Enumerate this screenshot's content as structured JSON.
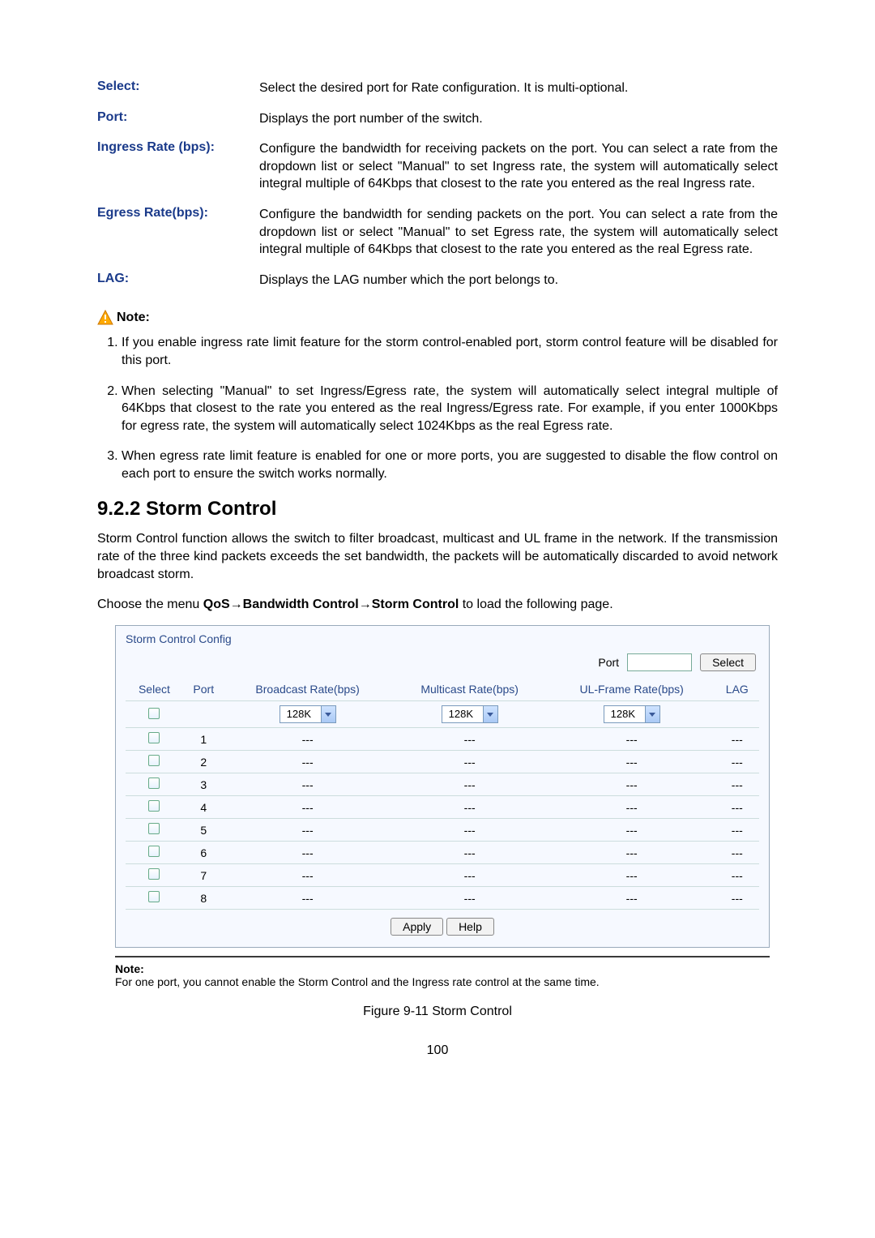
{
  "definitions": [
    {
      "term": "Select:",
      "desc": "Select the desired port for Rate configuration. It is multi-optional."
    },
    {
      "term": "Port:",
      "desc": "Displays the port number of the switch."
    },
    {
      "term": "Ingress Rate (bps):",
      "desc": "Configure the bandwidth for receiving packets on the port. You can select a rate from the dropdown list or select \"Manual\" to set Ingress rate, the system will automatically select integral multiple of 64Kbps that closest to the rate you entered as the real Ingress rate."
    },
    {
      "term": "Egress Rate(bps):",
      "desc": "Configure the bandwidth for sending packets on the port. You can select a rate from the dropdown list or select \"Manual\" to set Egress rate, the system will automatically select integral multiple of 64Kbps that closest to the rate you entered as the real Egress rate."
    },
    {
      "term": "LAG:",
      "desc": "Displays the LAG number which the port belongs to."
    }
  ],
  "note_label": "Note:",
  "notes": [
    "If you enable ingress rate limit feature for the storm control-enabled port, storm control feature will be disabled for this port.",
    "When selecting \"Manual\" to set Ingress/Egress rate, the system will automatically select integral multiple of 64Kbps that closest to the rate you entered as the real Ingress/Egress rate. For example, if you enter 1000Kbps for egress rate, the system will automatically select 1024Kbps as the real Egress rate.",
    "When egress rate limit feature is enabled for one or more ports, you are suggested to disable the flow control on each port to ensure the switch works normally."
  ],
  "section_heading": "9.2.2 Storm Control",
  "section_para1": "Storm Control function allows the switch to filter broadcast, multicast and UL frame in the network. If the transmission rate of the three kind packets exceeds the set bandwidth, the packets will be automatically discarded to avoid network broadcast storm.",
  "section_para2_pre": "Choose the menu ",
  "menu_path_1": "QoS",
  "arrow": "→",
  "menu_path_2": "Bandwidth Control",
  "menu_path_3": "Storm Control",
  "section_para2_post": " to load the following page.",
  "panel": {
    "title": "Storm Control Config",
    "port_label": "Port",
    "select_button": "Select",
    "headers": {
      "select": "Select",
      "port": "Port",
      "broadcast": "Broadcast Rate(bps)",
      "multicast": "Multicast Rate(bps)",
      "ulframe": "UL-Frame Rate(bps)",
      "lag": "LAG"
    },
    "dropdown_value": "128K",
    "rows": [
      {
        "port": "1",
        "broadcast": "---",
        "multicast": "---",
        "ulframe": "---",
        "lag": "---"
      },
      {
        "port": "2",
        "broadcast": "---",
        "multicast": "---",
        "ulframe": "---",
        "lag": "---"
      },
      {
        "port": "3",
        "broadcast": "---",
        "multicast": "---",
        "ulframe": "---",
        "lag": "---"
      },
      {
        "port": "4",
        "broadcast": "---",
        "multicast": "---",
        "ulframe": "---",
        "lag": "---"
      },
      {
        "port": "5",
        "broadcast": "---",
        "multicast": "---",
        "ulframe": "---",
        "lag": "---"
      },
      {
        "port": "6",
        "broadcast": "---",
        "multicast": "---",
        "ulframe": "---",
        "lag": "---"
      },
      {
        "port": "7",
        "broadcast": "---",
        "multicast": "---",
        "ulframe": "---",
        "lag": "---"
      },
      {
        "port": "8",
        "broadcast": "---",
        "multicast": "---",
        "ulframe": "---",
        "lag": "---"
      }
    ],
    "apply_button": "Apply",
    "help_button": "Help"
  },
  "panel_note_label": "Note:",
  "panel_note_text": "For one port, you cannot enable the Storm Control and the Ingress rate control at the same time.",
  "figure_caption": "Figure 9-11 Storm Control",
  "page_number": "100"
}
